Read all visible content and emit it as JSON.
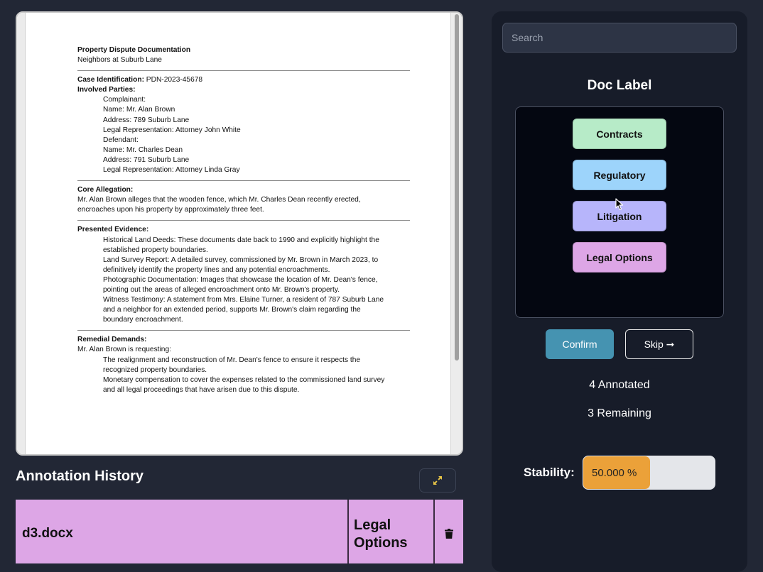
{
  "document": {
    "title": "Property Dispute Documentation",
    "subtitle": "Neighbors at Suburb Lane",
    "case_id_label": "Case Identification:",
    "case_id_value": " PDN-2023-45678",
    "parties_heading": "Involved Parties:",
    "parties_lines": [
      "Complainant:",
      "Name: Mr. Alan Brown",
      "Address: 789 Suburb Lane",
      "Legal Representation: Attorney John White",
      "Defendant:",
      "Name: Mr. Charles Dean",
      "Address: 791 Suburb Lane",
      "Legal Representation: Attorney Linda Gray"
    ],
    "allegation_heading": "Core Allegation:",
    "allegation_lines": [
      "Mr. Alan Brown alleges that the wooden fence, which Mr. Charles Dean recently erected,",
      "encroaches upon his property by approximately three feet."
    ],
    "evidence_heading": "Presented Evidence:",
    "evidence_lines": [
      "Historical Land Deeds: These documents date back to 1990 and explicitly highlight the",
      "established property boundaries.",
      "Land Survey Report: A detailed survey, commissioned by Mr. Brown in March 2023, to",
      "definitively identify the property lines and any potential encroachments.",
      "Photographic Documentation: Images that showcase the location of Mr. Dean's fence,",
      "pointing out the areas of alleged encroachment onto Mr. Brown's property.",
      "Witness Testimony: A statement from Mrs. Elaine Turner, a resident of 787 Suburb Lane",
      "and a neighbor for an extended period, supports Mr. Brown's claim regarding the",
      "boundary encroachment."
    ],
    "remedial_heading": "Remedial Demands:",
    "remedial_intro": "Mr. Alan Brown is requesting:",
    "remedial_lines": [
      "The realignment and reconstruction of Mr. Dean's fence to ensure it respects the",
      "recognized property boundaries.",
      "Monetary compensation to cover the expenses related to the commissioned land survey",
      "and all legal proceedings that have arisen due to this dispute."
    ]
  },
  "history": {
    "title": "Annotation History",
    "expand_icon": "expand-arrows-icon",
    "rows": [
      {
        "file": "d3.docx",
        "label_line1": "Legal",
        "label_line2": "Options",
        "color": "#dda6e6",
        "delete_icon": "trash-icon"
      }
    ]
  },
  "panel": {
    "search_placeholder": "Search",
    "doc_label_title": "Doc Label",
    "labels": [
      {
        "name": "Contracts",
        "color": "#b7ebc8"
      },
      {
        "name": "Regulatory",
        "color": "#9dd4fb"
      },
      {
        "name": "Litigation",
        "color": "#b7b5fb"
      },
      {
        "name": "Legal Options",
        "color": "#dda6e6"
      }
    ],
    "confirm_label": "Confirm",
    "skip_label": "Skip ➞",
    "annotated_text": "4 Annotated",
    "remaining_text": "3 Remaining",
    "stability_label": "Stability:",
    "stability_text": "50.000 %",
    "stability_fraction": 0.5,
    "stability_color": "#eba139"
  }
}
